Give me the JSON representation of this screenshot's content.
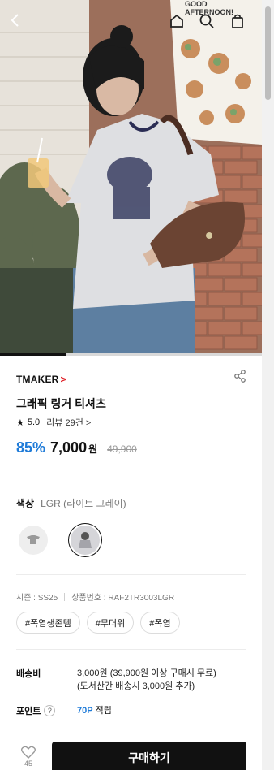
{
  "hero": {
    "sign_text_line1": "GOOD",
    "sign_text_line2": "AFTERNOON!",
    "carousel_progress": 0.25
  },
  "product": {
    "brand": "TMAKER",
    "brand_chevron": ">",
    "title": "그래픽 링거 티셔츠",
    "rating_star": "★",
    "rating": "5.0",
    "review_label": "리뷰 29건 >",
    "discount": "85%",
    "price": "7,000",
    "currency": "원",
    "original_price": "49,900"
  },
  "color": {
    "label": "색상",
    "value": "LGR (라이트 그레이)"
  },
  "meta": {
    "season": "시즌 : SS25",
    "product_no": "상품번호 : RAF2TR3003LGR"
  },
  "tags": [
    "#폭염생존템",
    "#무더위",
    "#폭염"
  ],
  "shipping": {
    "label": "배송비",
    "line1": "3,000원 (39,900원 이상 구매시 무료)",
    "line2": "(도서산간 배송시 3,000원 추가)"
  },
  "points": {
    "label": "포인트",
    "help": "?",
    "value": "70P",
    "suffix": "적립"
  },
  "bottom": {
    "like_count": "45",
    "buy_label": "구매하기"
  },
  "colors": {
    "accent_blue": "#1f7bd8",
    "brand_chevron": "#e0262d",
    "buy_button": "#111111"
  }
}
